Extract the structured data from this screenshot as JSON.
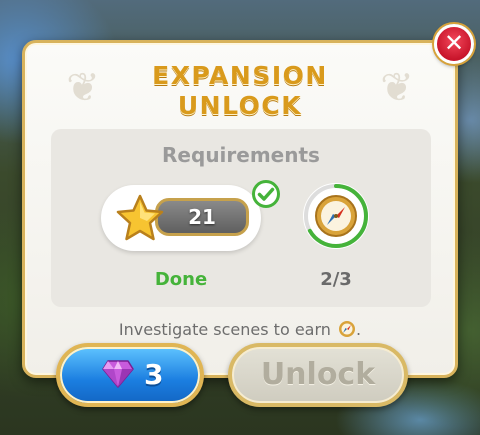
{
  "dialog": {
    "title_line1": "EXPANSION",
    "title_line2": "UNLOCK",
    "close_symbol": "✕"
  },
  "requirements": {
    "heading": "Requirements",
    "star": {
      "icon": "star-icon",
      "value": "21",
      "status": "Done",
      "completed": true
    },
    "compass": {
      "icon": "compass-icon",
      "progress": "2/3",
      "current": 2,
      "total": 3
    }
  },
  "hint": {
    "text": "Investigate scenes to earn",
    "icon": "compass-icon"
  },
  "buttons": {
    "gem_count": "3",
    "gem_icon": "gem-icon",
    "unlock_label": "Unlock",
    "unlock_enabled": false
  },
  "colors": {
    "title": "#d99a1c",
    "done": "#45b33a",
    "close": "#d7263a",
    "gem_button": "#1b7ee0",
    "frame_gold": "#d8b35c"
  }
}
